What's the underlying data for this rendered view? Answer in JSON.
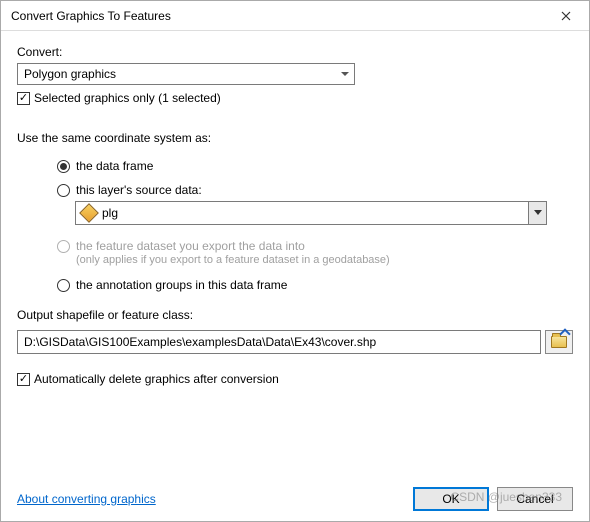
{
  "title": "Convert Graphics To Features",
  "convert": {
    "label": "Convert:",
    "selected": "Polygon graphics"
  },
  "selected_only": {
    "checked": true,
    "label": "Selected graphics only  (1 selected)"
  },
  "coord_label": "Use the same coordinate system as:",
  "radios": {
    "data_frame": "the data frame",
    "layer_source": "this layer's source data:",
    "layer_value": "plg",
    "feature_dataset": "the feature dataset you export the data into",
    "feature_dataset_sub": "(only applies if you export to a feature dataset in a geodatabase)",
    "annotation": "the annotation groups in this data frame"
  },
  "output": {
    "label": "Output shapefile or feature class:",
    "value": "D:\\GISData\\GIS100Examples\\examplesData\\Data\\Ex43\\cover.shp"
  },
  "auto_delete": {
    "checked": true,
    "label": "Automatically delete graphics after conversion"
  },
  "link": "About converting graphics",
  "buttons": {
    "ok": "OK",
    "cancel": "Cancel"
  },
  "watermark": "CSDN @jueshen333"
}
